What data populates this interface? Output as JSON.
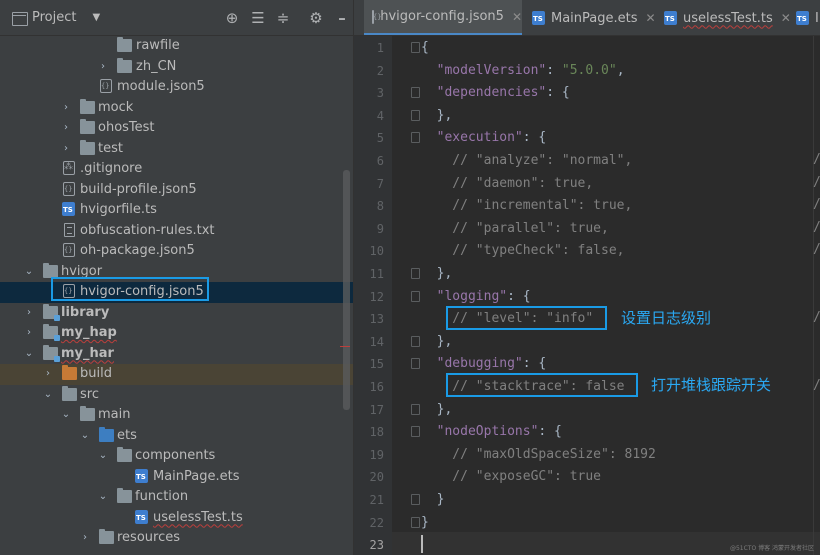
{
  "project_panel": {
    "title": "Project",
    "header_icons": [
      "crosshair-icon",
      "expand-all-icon",
      "collapse-all-icon",
      "gear-icon",
      "hide-icon"
    ],
    "items": [
      {
        "label": "rawfile",
        "icon": "folder-icon"
      },
      {
        "label": "zh_CN",
        "icon": "folder-icon"
      },
      {
        "label": "module.json5",
        "icon": "json-file-icon"
      },
      {
        "label": "mock",
        "icon": "folder-icon"
      },
      {
        "label": "ohosTest",
        "icon": "folder-icon"
      },
      {
        "label": "test",
        "icon": "folder-icon"
      },
      {
        "label": ".gitignore",
        "icon": "gitignore-file-icon"
      },
      {
        "label": "build-profile.json5",
        "icon": "json-file-icon"
      },
      {
        "label": "hvigorfile.ts",
        "icon": "ts-file-icon"
      },
      {
        "label": "obfuscation-rules.txt",
        "icon": "text-file-icon"
      },
      {
        "label": "oh-package.json5",
        "icon": "json-file-icon"
      },
      {
        "label": "hvigor",
        "icon": "folder-icon"
      },
      {
        "label": "hvigor-config.json5",
        "icon": "json-file-icon"
      },
      {
        "label": "library",
        "icon": "module-folder-icon"
      },
      {
        "label": "my_hap",
        "icon": "module-folder-icon"
      },
      {
        "label": "my_har",
        "icon": "module-folder-icon"
      },
      {
        "label": "build",
        "icon": "build-folder-icon"
      },
      {
        "label": "src",
        "icon": "folder-icon"
      },
      {
        "label": "main",
        "icon": "folder-icon"
      },
      {
        "label": "ets",
        "icon": "source-folder-icon"
      },
      {
        "label": "components",
        "icon": "folder-icon"
      },
      {
        "label": "MainPage.ets",
        "icon": "ts-file-icon"
      },
      {
        "label": "function",
        "icon": "folder-icon"
      },
      {
        "label": "uselessTest.ts",
        "icon": "ts-file-icon"
      },
      {
        "label": "resources",
        "icon": "folder-icon"
      }
    ]
  },
  "editor": {
    "tabs": [
      {
        "label": "hvigor-config.json5",
        "active": true
      },
      {
        "label": "MainPage.ets",
        "active": false
      },
      {
        "label": "uselessTest.ts",
        "active": false
      },
      {
        "label": "In",
        "active": false
      }
    ],
    "line_numbers": [
      "1",
      "2",
      "3",
      "4",
      "5",
      "6",
      "7",
      "8",
      "9",
      "10",
      "11",
      "12",
      "13",
      "14",
      "15",
      "16",
      "17",
      "18",
      "19",
      "20",
      "21",
      "22",
      "23"
    ],
    "current_line": 23,
    "code_lines": [
      [
        [
          "{",
          "punc"
        ]
      ],
      [
        [
          "  ",
          "punc"
        ],
        [
          "\"modelVersion\"",
          "key"
        ],
        [
          ": ",
          "punc"
        ],
        [
          "\"5.0.0\"",
          "str"
        ],
        [
          ",",
          "punc"
        ]
      ],
      [
        [
          "  ",
          "punc"
        ],
        [
          "\"dependencies\"",
          "key"
        ],
        [
          ": {",
          "punc"
        ]
      ],
      [
        [
          "  },",
          "punc"
        ]
      ],
      [
        [
          "  ",
          "punc"
        ],
        [
          "\"execution\"",
          "key"
        ],
        [
          ": {",
          "punc"
        ]
      ],
      [
        [
          "    // \"analyze\": \"normal\",",
          "cmt"
        ]
      ],
      [
        [
          "    // \"daemon\": true,",
          "cmt"
        ]
      ],
      [
        [
          "    // \"incremental\": true,",
          "cmt"
        ]
      ],
      [
        [
          "    // \"parallel\": true,",
          "cmt"
        ]
      ],
      [
        [
          "    // \"typeCheck\": false,",
          "cmt"
        ]
      ],
      [
        [
          "  },",
          "punc"
        ]
      ],
      [
        [
          "  ",
          "punc"
        ],
        [
          "\"logging\"",
          "key"
        ],
        [
          ": {",
          "punc"
        ]
      ],
      [
        [
          "    // \"level\": \"info\"",
          "cmt"
        ]
      ],
      [
        [
          "  },",
          "punc"
        ]
      ],
      [
        [
          "  ",
          "punc"
        ],
        [
          "\"debugging\"",
          "key"
        ],
        [
          ": {",
          "punc"
        ]
      ],
      [
        [
          "    // \"stacktrace\": false",
          "cmt"
        ]
      ],
      [
        [
          "  },",
          "punc"
        ]
      ],
      [
        [
          "  ",
          "punc"
        ],
        [
          "\"nodeOptions\"",
          "key"
        ],
        [
          ": {",
          "punc"
        ]
      ],
      [
        [
          "    // \"maxOldSpaceSize\": 8192",
          "cmt"
        ]
      ],
      [
        [
          "    // \"exposeGC\": true",
          "cmt"
        ]
      ],
      [
        [
          "  }",
          "punc"
        ]
      ],
      [
        [
          "}",
          "punc"
        ]
      ],
      [
        [
          "",
          "punc"
        ]
      ]
    ],
    "annotations": {
      "logging_note": "设置日志级别",
      "debugging_note": "打开堆栈跟踪开关"
    },
    "watermark": "@51CTO 博客 鸿蒙开发者社区"
  },
  "colors": {
    "highlight_box": "#1a9be6",
    "annotation_text": "#2aa8f2",
    "selected_row": "#0d293e",
    "active_tab_underline": "#4a88c7"
  }
}
